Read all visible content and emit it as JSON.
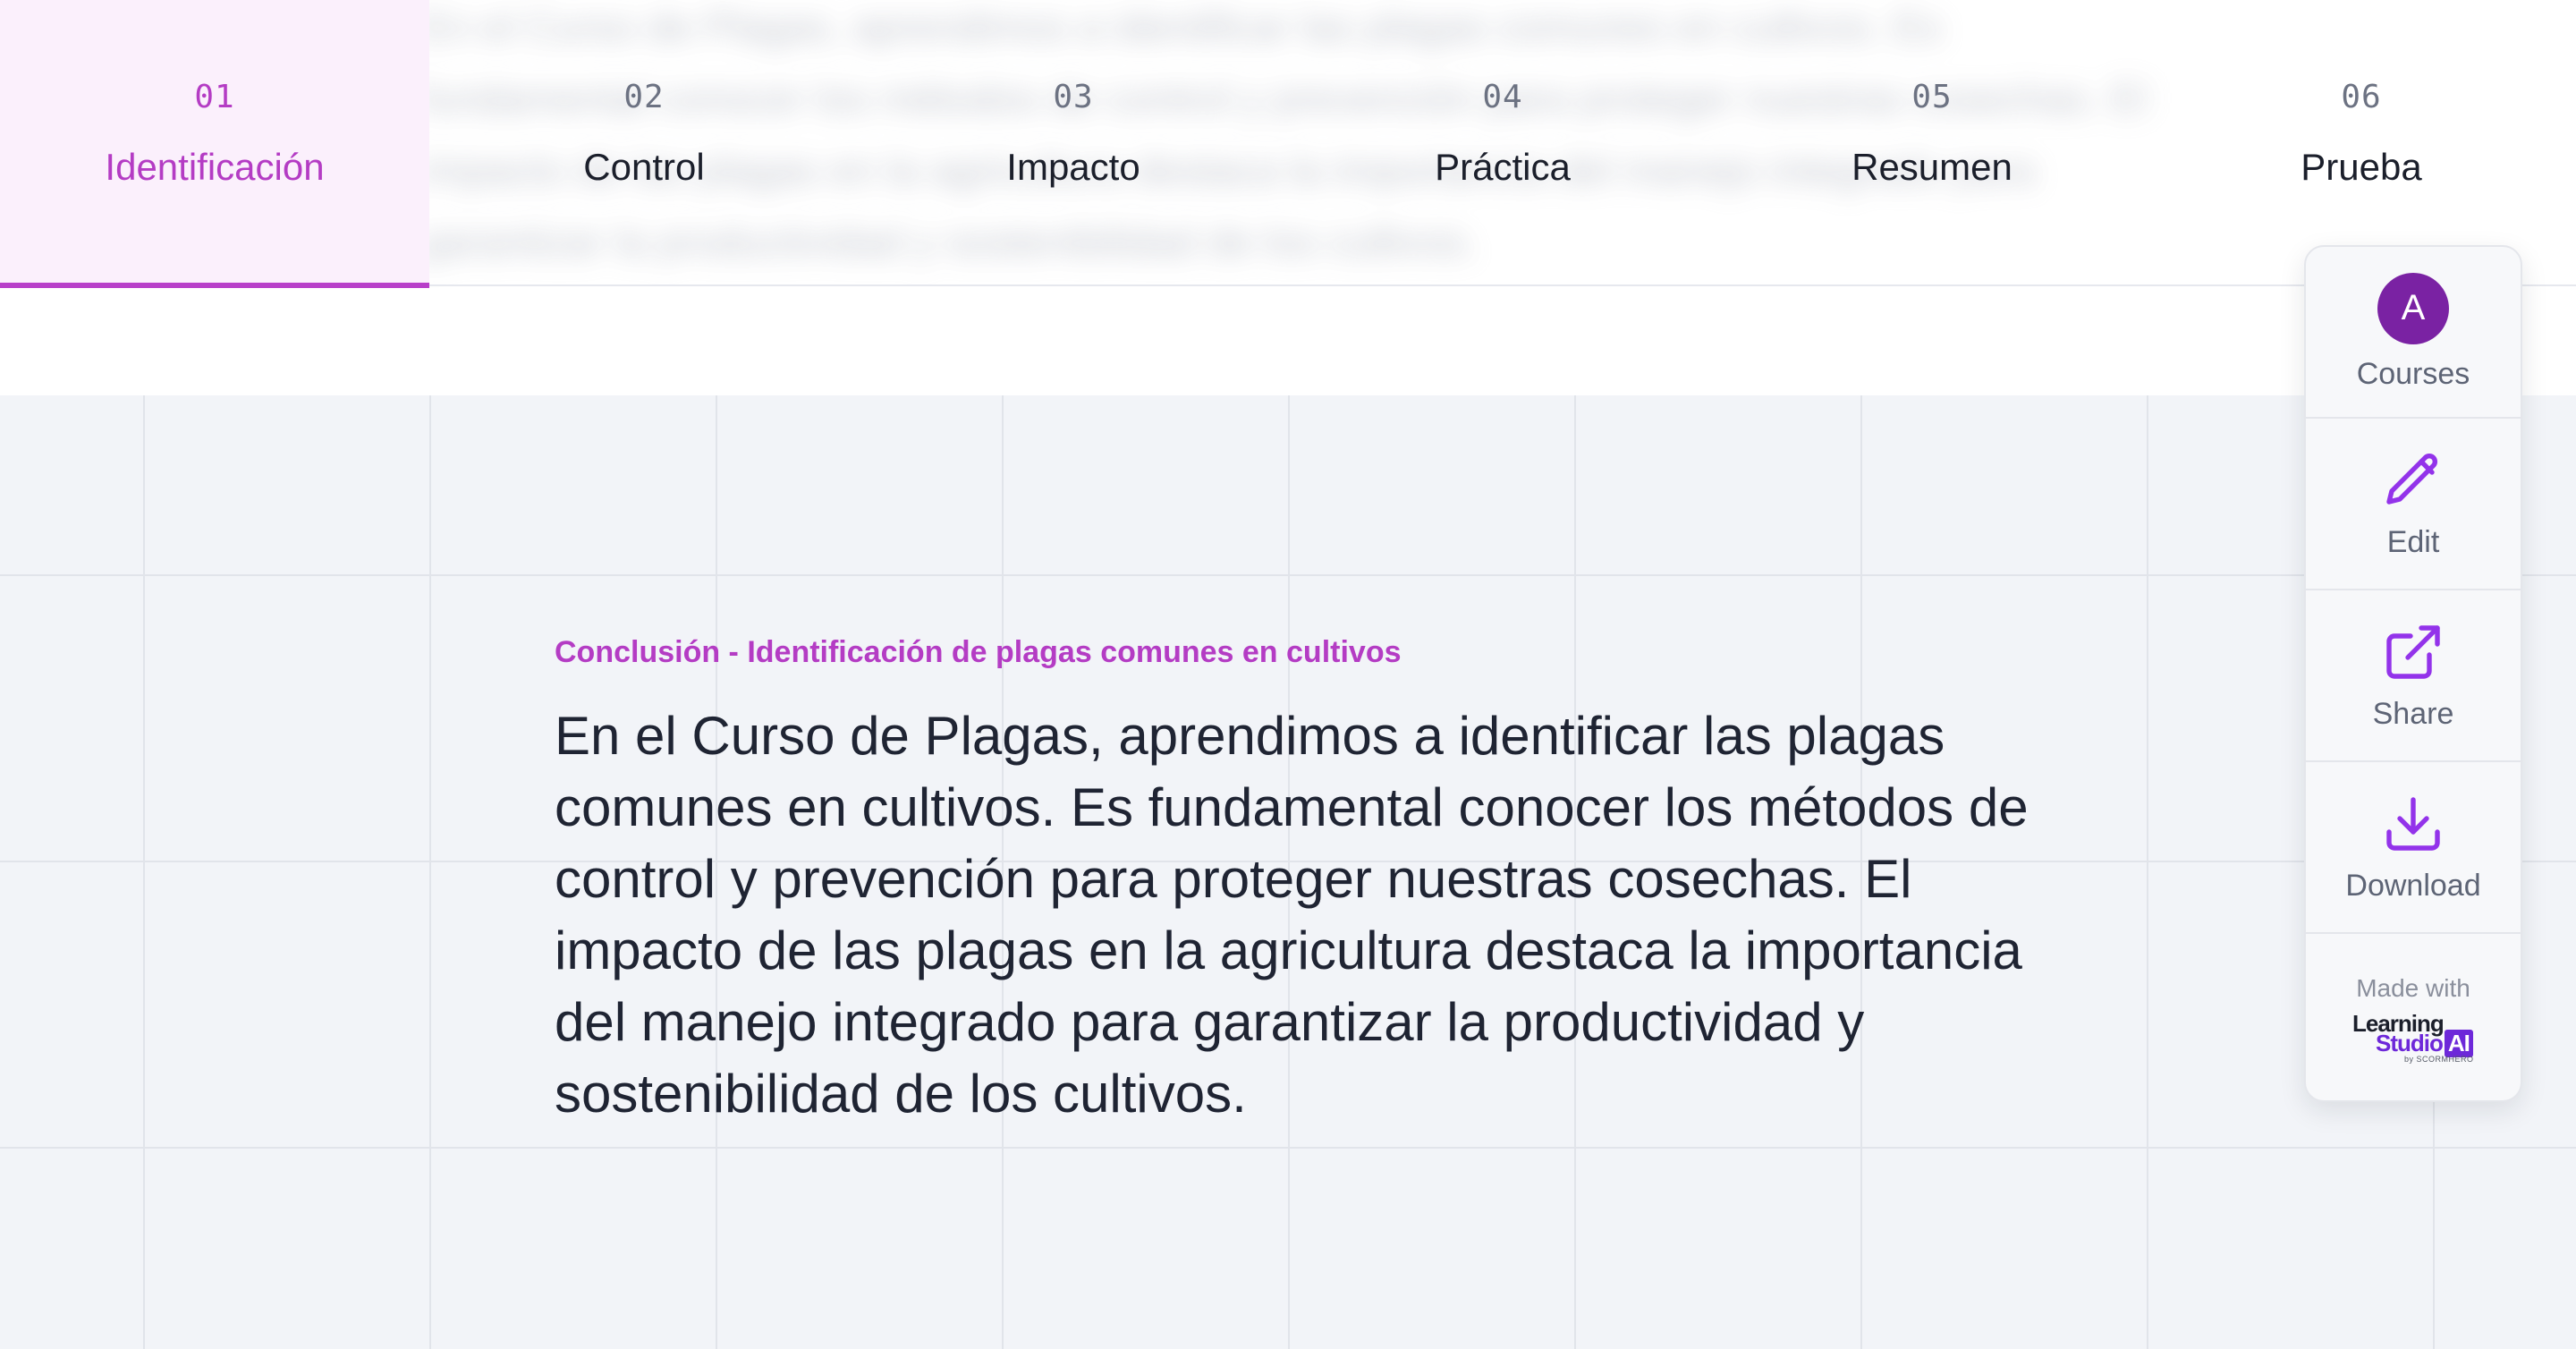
{
  "tabs": [
    {
      "num": "01",
      "label": "Identificación",
      "active": true
    },
    {
      "num": "02",
      "label": "Control",
      "active": false
    },
    {
      "num": "03",
      "label": "Impacto",
      "active": false
    },
    {
      "num": "04",
      "label": "Práctica",
      "active": false
    },
    {
      "num": "05",
      "label": "Resumen",
      "active": false
    },
    {
      "num": "06",
      "label": "Prueba",
      "active": false
    }
  ],
  "section": {
    "eyebrow": "Conclusión - Identificación de plagas comunes en cultivos",
    "body": "En el Curso de Plagas, aprendimos a identificar las plagas comunes en cultivos. Es fundamental conocer los métodos de control y prevención para proteger nuestras cosechas. El impacto de las plagas en la agricultura destaca la importancia del manejo integrado para garantizar la productividad y sostenibilidad de los cultivos."
  },
  "side_panel": {
    "avatar_letter": "A",
    "courses_label": "Courses",
    "edit_label": "Edit",
    "share_label": "Share",
    "download_label": "Download",
    "made_with": "Made with",
    "brand_top": "Learning",
    "brand_bottom": "Studio",
    "brand_ai": "AI",
    "brand_by": "by SCORMHERO",
    "accent_color": "#7a22a3",
    "icons": [
      "pencil-icon",
      "external-link-icon",
      "download-icon"
    ]
  },
  "colors": {
    "accent": "#b43cc4",
    "active_tab_bg": "#fbf0fc",
    "content_bg": "#f2f4f8",
    "text": "#1f2433"
  }
}
